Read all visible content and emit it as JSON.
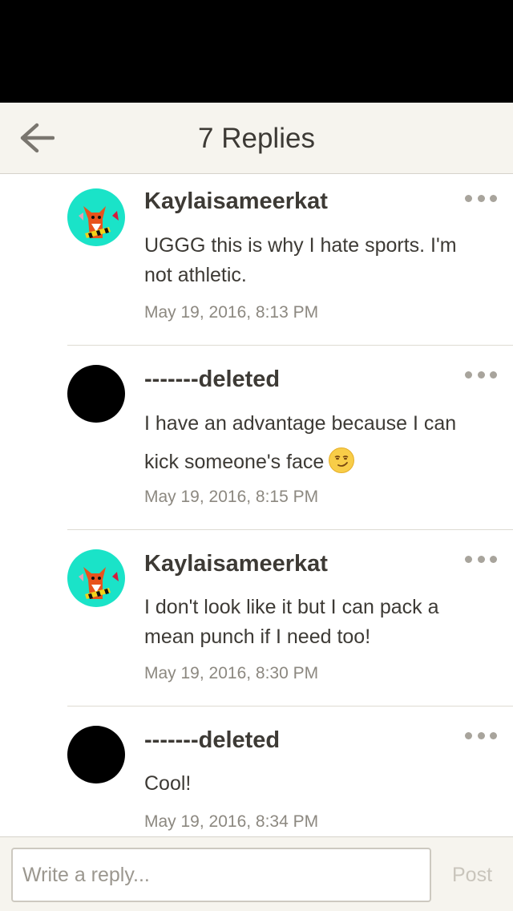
{
  "header": {
    "title": "7 Replies",
    "back_icon": "arrow-left-icon"
  },
  "comments": [
    {
      "username": "Kaylaisameerkat",
      "avatar": "fox-avatar",
      "text": "UGGG this is why I hate sports. I'm not athletic.",
      "time": "May 19, 2016, 8:13 PM"
    },
    {
      "username": "-------deleted",
      "avatar": "black-avatar",
      "text": "I have an advantage because I can kick someone's face",
      "emoji": "smirking-face-emoji",
      "time": "May 19, 2016, 8:15 PM"
    },
    {
      "username": "Kaylaisameerkat",
      "avatar": "fox-avatar",
      "text": "I don't look like it but I can pack a mean punch if I need too!",
      "time": "May 19, 2016, 8:30 PM"
    },
    {
      "username": "-------deleted",
      "avatar": "black-avatar",
      "text": "Cool!",
      "time": "May 19, 2016, 8:34 PM"
    }
  ],
  "footer": {
    "placeholder": "Write a reply...",
    "post_label": "Post"
  },
  "colors": {
    "header_bg": "#f6f4ee",
    "text": "#3d3a35",
    "muted": "#8c8880",
    "avatar_teal": "#1ae3c8"
  }
}
